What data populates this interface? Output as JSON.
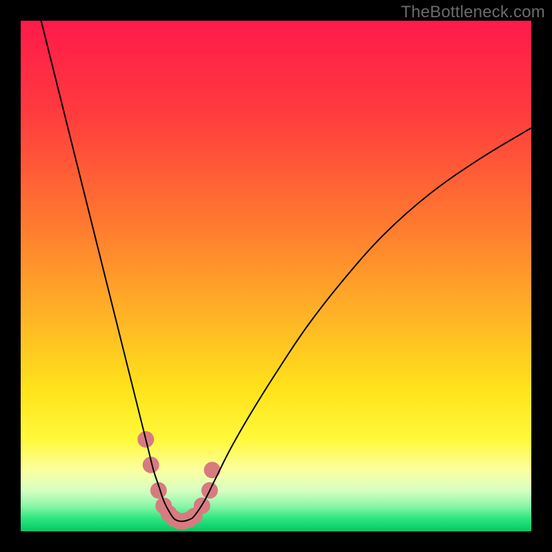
{
  "watermark": "TheBottleneck.com",
  "chart_data": {
    "type": "line",
    "title": "",
    "xlabel": "",
    "ylabel": "",
    "xlim": [
      0,
      100
    ],
    "ylim": [
      0,
      100
    ],
    "gradient_stops": [
      {
        "offset": 0.0,
        "color": "#ff1a4b"
      },
      {
        "offset": 0.18,
        "color": "#ff3b3e"
      },
      {
        "offset": 0.4,
        "color": "#ff7a2f"
      },
      {
        "offset": 0.58,
        "color": "#ffb426"
      },
      {
        "offset": 0.72,
        "color": "#ffe21a"
      },
      {
        "offset": 0.82,
        "color": "#fff93a"
      },
      {
        "offset": 0.88,
        "color": "#fbffa0"
      },
      {
        "offset": 0.92,
        "color": "#d8ffc2"
      },
      {
        "offset": 0.95,
        "color": "#8cf6a8"
      },
      {
        "offset": 0.975,
        "color": "#2de57e"
      },
      {
        "offset": 1.0,
        "color": "#05c768"
      }
    ],
    "series": [
      {
        "name": "bottleneck-curve",
        "color": "#000000",
        "width": 2,
        "x": [
          4,
          6,
          8,
          10,
          12,
          14,
          16,
          18,
          20,
          22,
          24,
          25,
          26,
          27,
          28,
          29,
          30,
          31,
          32,
          33,
          34,
          36,
          38,
          41,
          45,
          50,
          56,
          63,
          71,
          80,
          90,
          100
        ],
        "y": [
          100,
          92,
          84,
          76,
          68,
          60,
          52,
          44,
          36,
          28,
          20,
          16,
          12,
          9,
          6,
          4,
          2.5,
          2,
          2,
          2.3,
          3,
          6,
          10,
          16,
          23,
          31,
          40,
          49,
          58,
          66,
          73,
          79
        ]
      }
    ],
    "markers": {
      "name": "highlight-dots",
      "color": "#d77b80",
      "radius": 12,
      "points": [
        {
          "x": 24.5,
          "y": 18
        },
        {
          "x": 25.5,
          "y": 13
        },
        {
          "x": 27.0,
          "y": 8
        },
        {
          "x": 28.0,
          "y": 5
        },
        {
          "x": 29.0,
          "y": 3.5
        },
        {
          "x": 30.0,
          "y": 2.5
        },
        {
          "x": 31.0,
          "y": 2.0
        },
        {
          "x": 32.0,
          "y": 2.0
        },
        {
          "x": 33.0,
          "y": 2.3
        },
        {
          "x": 34.0,
          "y": 3.0
        },
        {
          "x": 35.5,
          "y": 5.0
        },
        {
          "x": 37.0,
          "y": 8.0
        },
        {
          "x": 37.5,
          "y": 12.0
        }
      ]
    }
  }
}
